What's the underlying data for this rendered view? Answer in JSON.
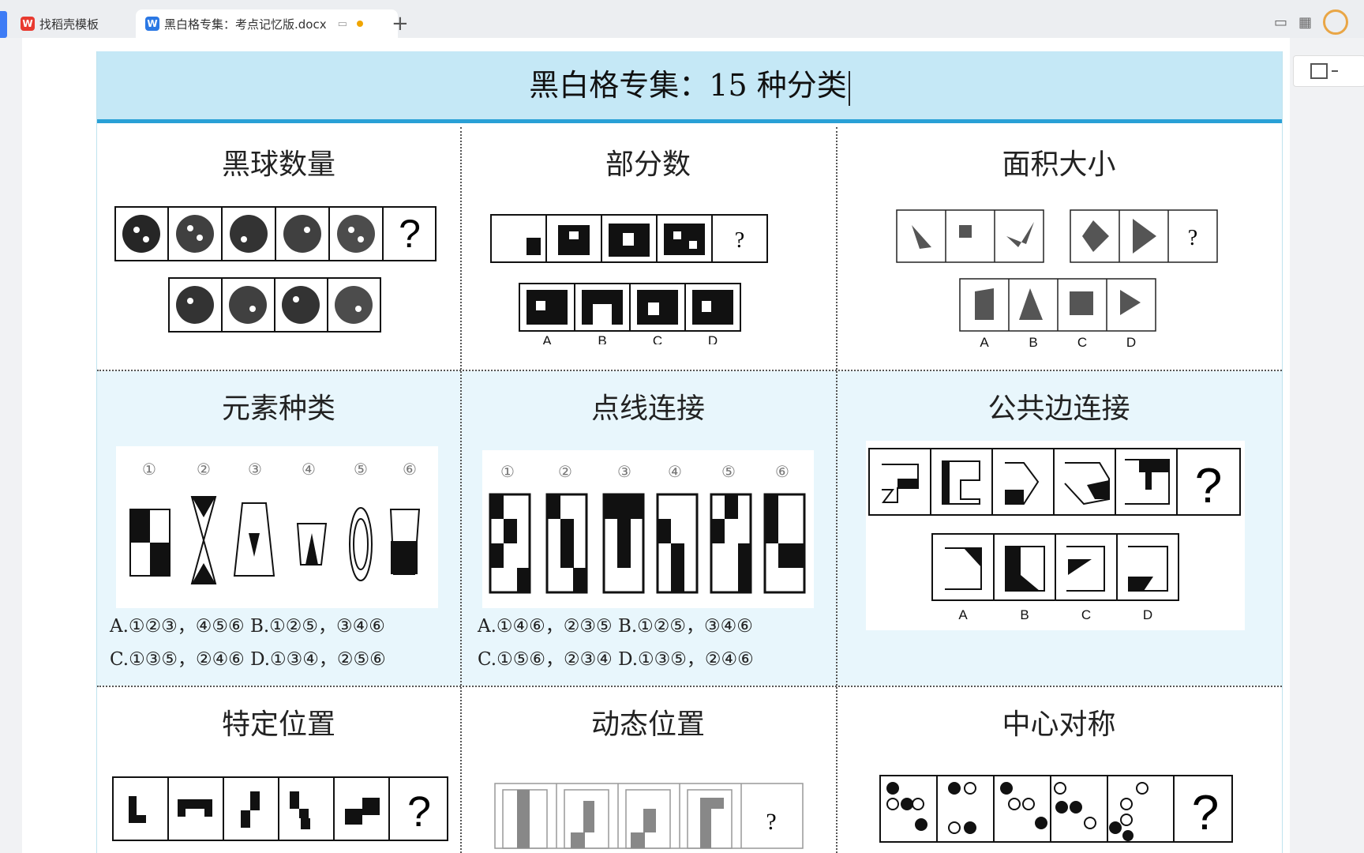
{
  "tabs": [
    {
      "label": "找稻壳模板",
      "icon": "wps-icon"
    },
    {
      "label": "黑白格专集：考点记忆版.docx",
      "icon": "word-icon"
    }
  ],
  "new_tab": "+",
  "document": {
    "title": "黑白格专集：15 种分类",
    "cells": [
      {
        "heading": "黑球数量",
        "labels": [
          "A",
          "B",
          "C",
          "D"
        ]
      },
      {
        "heading": "部分数",
        "labels": [
          "A",
          "B",
          "C",
          "D"
        ]
      },
      {
        "heading": "面积大小",
        "labels": [
          "A",
          "B",
          "C",
          "D"
        ]
      },
      {
        "heading": "元素种类",
        "numbers": [
          "①",
          "②",
          "③",
          "④",
          "⑤",
          "⑥"
        ],
        "options": [
          "A.①②③，④⑤⑥ B.①②⑤，③④⑥",
          "C.①③⑤，②④⑥ D.①③④，②⑤⑥"
        ]
      },
      {
        "heading": "点线连接",
        "numbers": [
          "①",
          "②",
          "③",
          "④",
          "⑤",
          "⑥"
        ],
        "options": [
          "A.①④⑥，②③⑤ B.①②⑤，③④⑥",
          "C.①⑤⑥，②③④ D.①③⑤，②④⑥"
        ]
      },
      {
        "heading": "公共边连接",
        "labels": [
          "A",
          "B",
          "C",
          "D"
        ]
      },
      {
        "heading": "特定位置"
      },
      {
        "heading": "动态位置"
      },
      {
        "heading": "中心对称"
      }
    ],
    "question_mark": "?"
  },
  "colors": {
    "title_bg": "#c5e8f6",
    "title_border": "#29a0d6",
    "row_bg": "#e8f6fc"
  }
}
